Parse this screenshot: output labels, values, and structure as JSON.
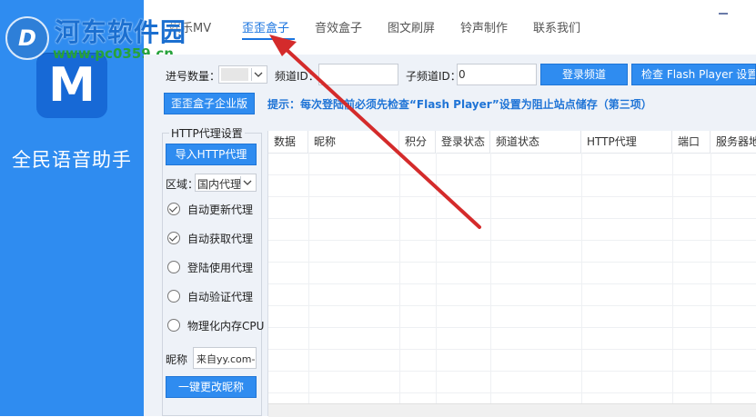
{
  "app": {
    "name": "全民语音助手",
    "logo_letter": "M"
  },
  "watermark": {
    "title": "河东软件园",
    "url": "www.pc0359.cn",
    "badge": "D"
  },
  "nav": {
    "items": [
      {
        "label": "娱乐MV"
      },
      {
        "label": "歪歪盒子"
      },
      {
        "label": "音效盒子"
      },
      {
        "label": "图文刷屏"
      },
      {
        "label": "铃声制作"
      },
      {
        "label": "联系我们"
      }
    ],
    "active_index": 1
  },
  "form": {
    "queue_label": "进号数量：",
    "channel_label": "频道ID：",
    "subchannel_label": "子频道ID：",
    "subchannel_value": "0",
    "login_button": "登录频道",
    "check_flash_button": "检查 Flash Player 设置",
    "enterprise_button": "歪歪盒子企业版",
    "hint": "提示：每次登陆前必须先检查“Flash Player”设置为阻止站点储存（第三项）"
  },
  "proxy": {
    "group_title": "HTTP代理设置",
    "import_button": "导入HTTP代理",
    "region_label": "区域：",
    "region_value": "国内代理",
    "options": [
      {
        "label": "自动更新代理",
        "checked": true
      },
      {
        "label": "自动获取代理",
        "checked": true
      },
      {
        "label": "登陆使用代理",
        "checked": false
      },
      {
        "label": "自动验证代理",
        "checked": false
      },
      {
        "label": "物理化内存CPU",
        "checked": false
      }
    ],
    "nickname_label": "昵称",
    "nickname_value": "来自yy.com-",
    "change_nick_button": "一键更改昵称"
  },
  "table": {
    "columns": [
      "数据",
      "昵称",
      "积分",
      "登录状态",
      "频道状态",
      "HTTP代理",
      "端口",
      "服务器地"
    ]
  },
  "colors": {
    "sidebar": "#2f8cf0",
    "accent": "#1c76e0",
    "annotation_arrow": "#d42b2b"
  }
}
